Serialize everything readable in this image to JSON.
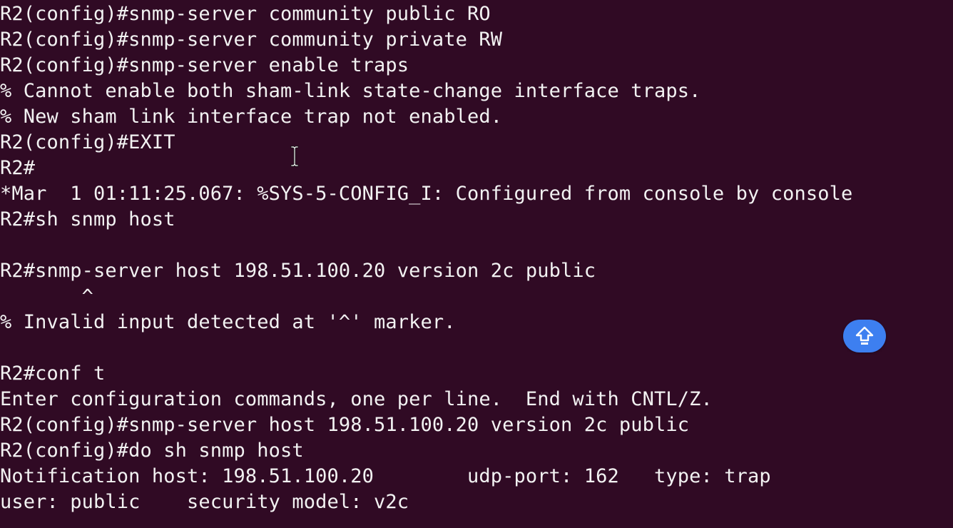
{
  "terminal": {
    "lines": [
      "R2(config)#snmp-server community public RO",
      "R2(config)#snmp-server community private RW",
      "R2(config)#snmp-server enable traps",
      "% Cannot enable both sham-link state-change interface traps.",
      "% New sham link interface trap not enabled.",
      "R2(config)#EXIT",
      "R2#",
      "*Mar  1 01:11:25.067: %SYS-5-CONFIG_I: Configured from console by console",
      "R2#sh snmp host",
      "",
      "R2#snmp-server host 198.51.100.20 version 2c public",
      "       ^",
      "% Invalid input detected at '^' marker.",
      "",
      "R2#conf t",
      "Enter configuration commands, one per line.  End with CNTL/Z.",
      "R2(config)#snmp-server host 198.51.100.20 version 2c public",
      "R2(config)#do sh snmp host",
      "Notification host: 198.51.100.20        udp-port: 162   type: trap",
      "user: public    security model: v2c"
    ]
  },
  "icons": {
    "text_cursor": "i-beam-cursor-icon",
    "scroll_top": "arrow-up-icon"
  },
  "colors": {
    "background": "#300a24",
    "text": "#f2f2f2",
    "button": "#3d7ff0"
  }
}
